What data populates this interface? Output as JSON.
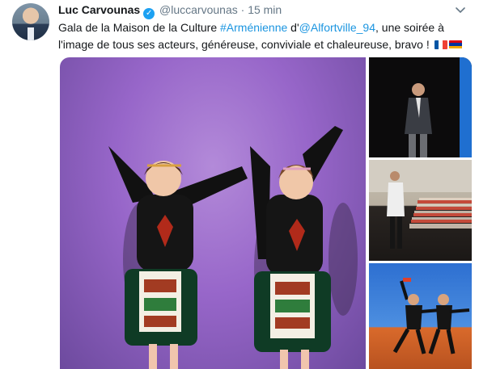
{
  "author": {
    "name": "Luc Carvounas",
    "handle": "@luccarvounas",
    "separator": "·",
    "time": "15 min",
    "verified_icon": "verified-badge-icon"
  },
  "tweet": {
    "text_part1": "Gala de la Maison de la Culture ",
    "hashtag": "#Arménienne",
    "text_part2": " d'",
    "mention": "@Alfortville_94",
    "text_part3": ", une soirée à l'image de tous ses acteurs, généreuse, conviviale et chaleureuse, bravo ! ",
    "emoji_flags": [
      "flag-france-icon",
      "flag-armenia-icon"
    ]
  },
  "colors": {
    "link": "#1b95e0",
    "verified": "#1da1f2",
    "text": "#14171a",
    "muted": "#657786"
  },
  "media": {
    "count": 4,
    "photos": [
      "children-dancers-photo",
      "speaker-on-stage-photo",
      "audience-hall-photo",
      "boy-dancers-photo"
    ]
  }
}
